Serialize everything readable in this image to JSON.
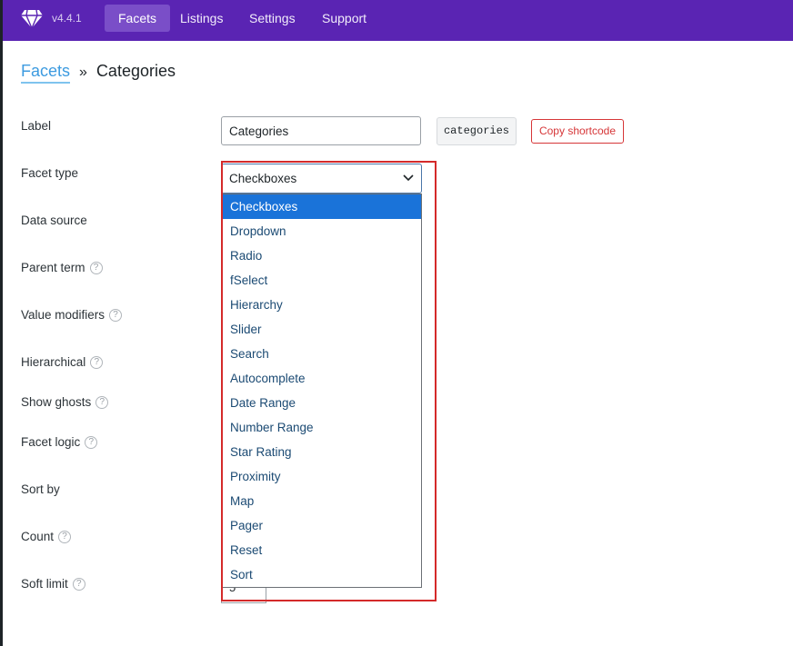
{
  "nav": {
    "version": "v4.4.1",
    "items": [
      {
        "label": "Facets",
        "active": true
      },
      {
        "label": "Listings",
        "active": false
      },
      {
        "label": "Settings",
        "active": false
      },
      {
        "label": "Support",
        "active": false
      }
    ]
  },
  "breadcrumb": {
    "parent": "Facets",
    "separator": "»",
    "current": "Categories"
  },
  "form": {
    "labels": {
      "label": "Label",
      "facet_type": "Facet type",
      "data_source": "Data source",
      "parent_term": "Parent term",
      "value_modifiers": "Value modifiers",
      "hierarchical": "Hierarchical",
      "show_ghosts": "Show ghosts",
      "facet_logic": "Facet logic",
      "sort_by": "Sort by",
      "count": "Count",
      "soft_limit": "Soft limit"
    },
    "help_icon": "?",
    "label_value": "Categories",
    "slug": "categories",
    "copy_shortcode": "Copy shortcode",
    "facet_type_selected": "Checkboxes",
    "soft_limit_value": "5"
  },
  "dropdown": {
    "options": [
      "Checkboxes",
      "Dropdown",
      "Radio",
      "fSelect",
      "Hierarchy",
      "Slider",
      "Search",
      "Autocomplete",
      "Date Range",
      "Number Range",
      "Star Rating",
      "Proximity",
      "Map",
      "Pager",
      "Reset",
      "Sort"
    ],
    "selected_index": 0
  },
  "colors": {
    "topbar": "#5a24b3",
    "accent_link": "#3d9be0",
    "danger": "#d63638",
    "selected_option": "#1a73d9",
    "highlight_box": "#d42a2a"
  }
}
